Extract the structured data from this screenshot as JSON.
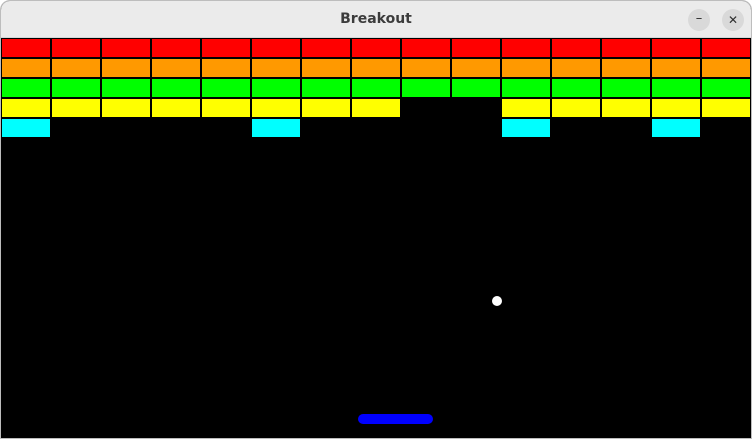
{
  "window": {
    "title": "Breakout",
    "minimize_glyph": "–",
    "close_glyph": "✕"
  },
  "colors": {
    "background": "#000000",
    "ball": "#ffffff",
    "paddle": "#0000ff",
    "rows": [
      "#ff0000",
      "#ff9900",
      "#00ff00",
      "#ffff00",
      "#00ffff"
    ]
  },
  "bricks": {
    "columns": 15,
    "rows": [
      {
        "color": "red",
        "present": [
          1,
          1,
          1,
          1,
          1,
          1,
          1,
          1,
          1,
          1,
          1,
          1,
          1,
          1,
          1
        ]
      },
      {
        "color": "orange",
        "present": [
          1,
          1,
          1,
          1,
          1,
          1,
          1,
          1,
          1,
          1,
          1,
          1,
          1,
          1,
          1
        ]
      },
      {
        "color": "green",
        "present": [
          1,
          1,
          1,
          1,
          1,
          1,
          1,
          1,
          1,
          1,
          1,
          1,
          1,
          1,
          1
        ]
      },
      {
        "color": "yellow",
        "present": [
          1,
          1,
          1,
          1,
          1,
          1,
          1,
          1,
          0,
          0,
          1,
          1,
          1,
          1,
          1
        ]
      },
      {
        "color": "cyan",
        "present": [
          1,
          0,
          0,
          0,
          0,
          1,
          0,
          0,
          0,
          0,
          1,
          0,
          0,
          1,
          0
        ]
      }
    ]
  }
}
